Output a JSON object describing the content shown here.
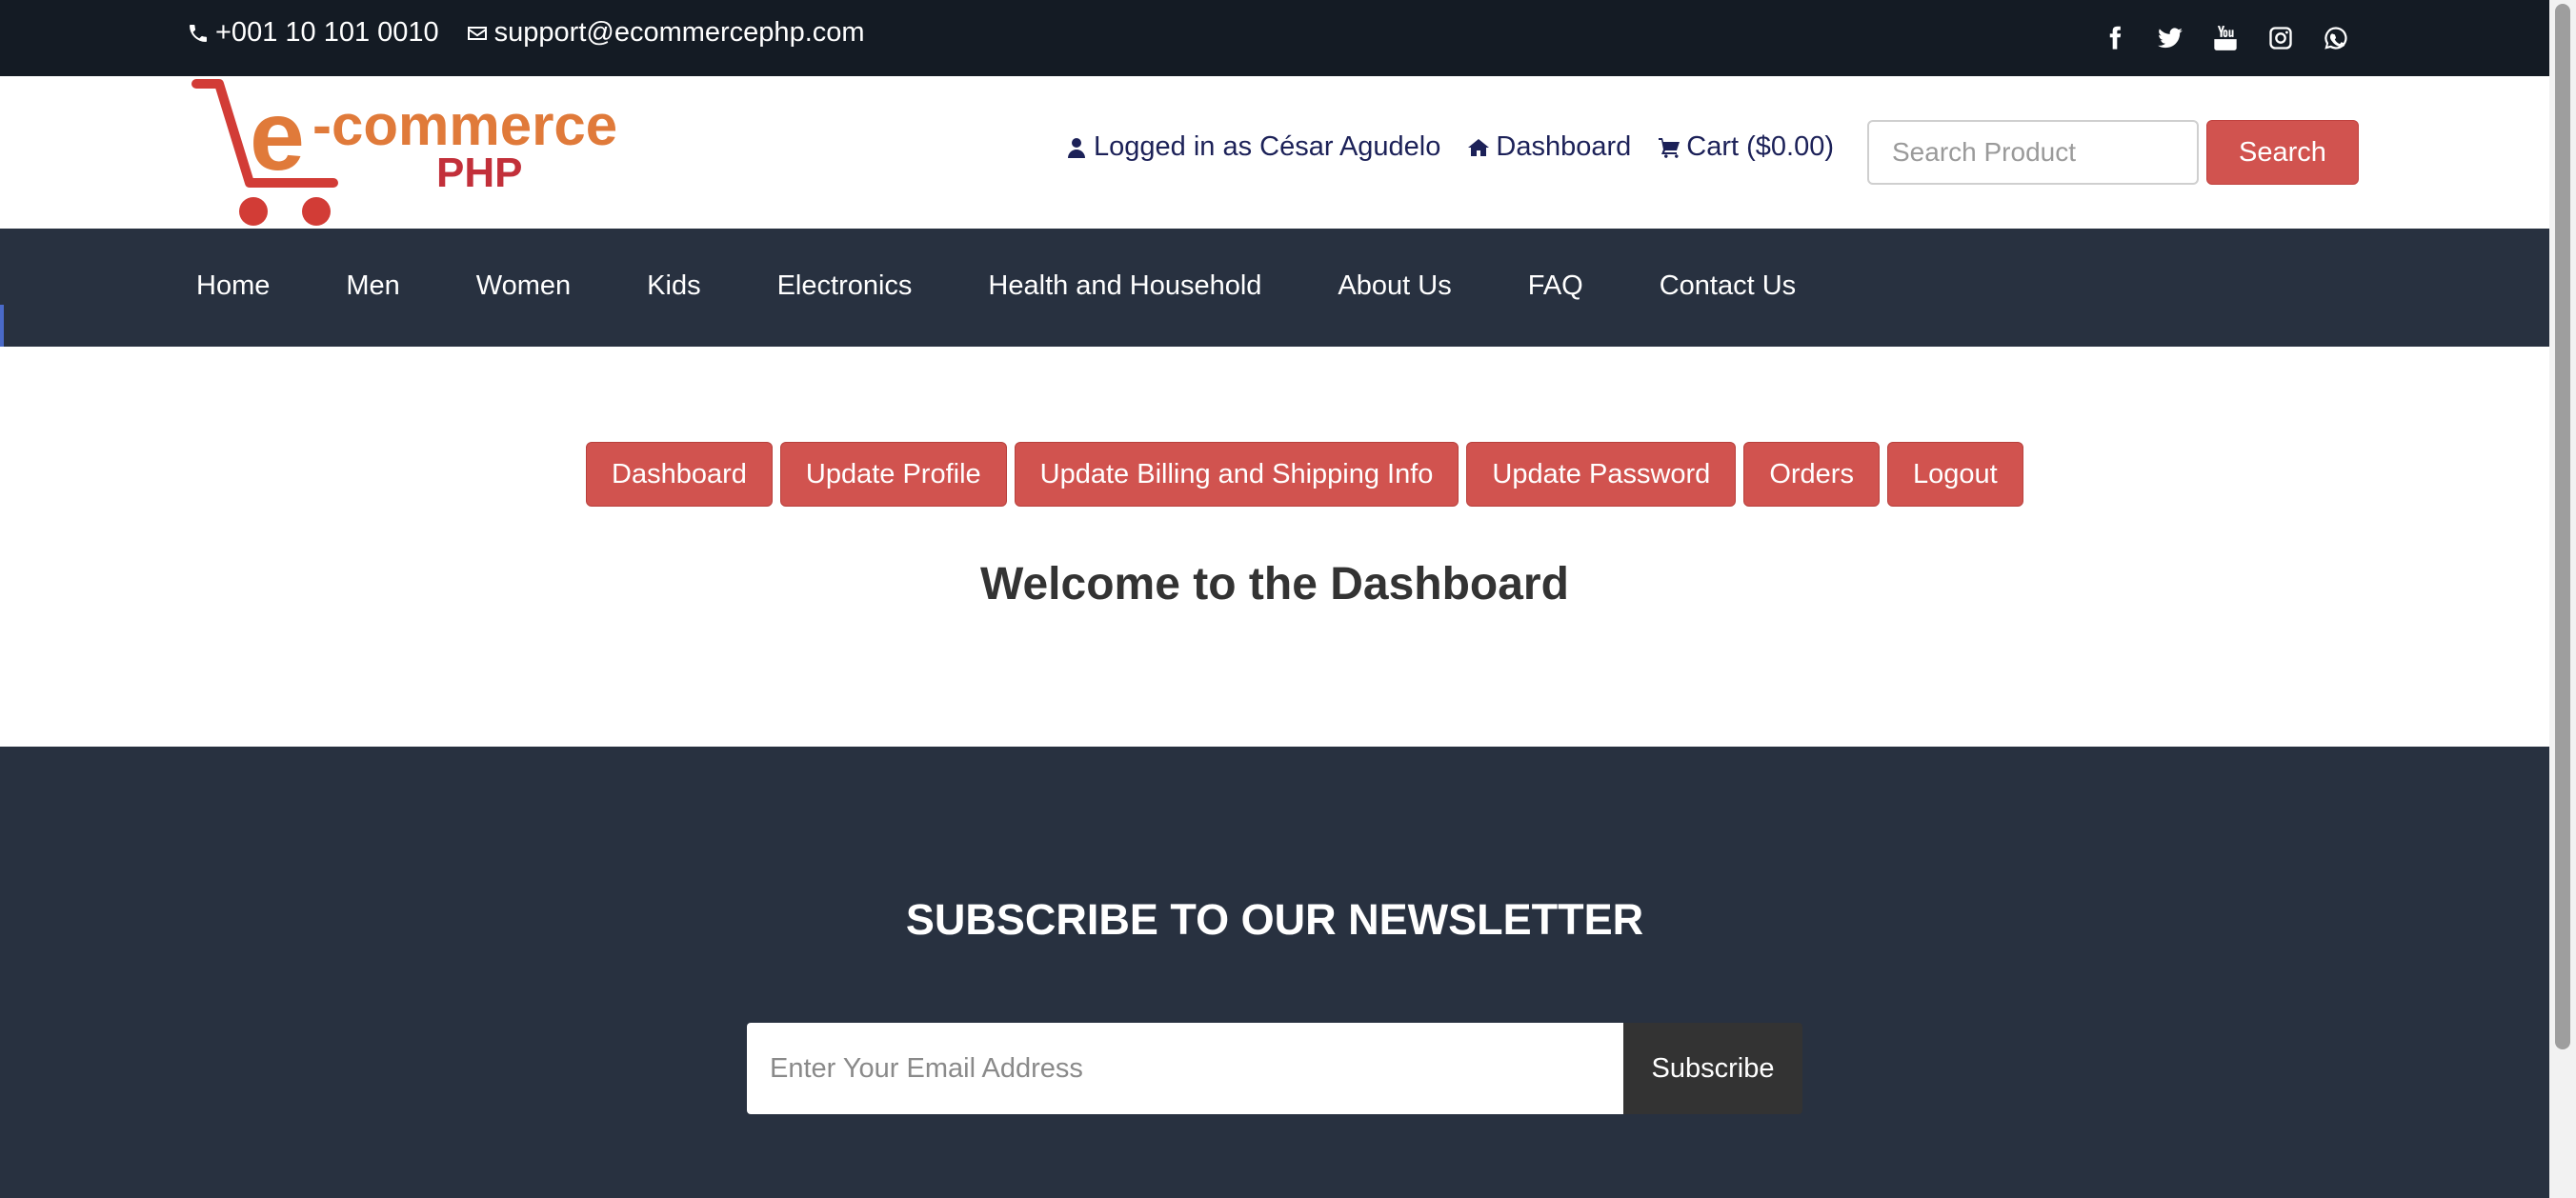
{
  "topbar": {
    "phone": "+001 10 101 0010",
    "email": "support@ecommercephp.com",
    "social_icons": [
      "facebook-icon",
      "twitter-icon",
      "youtube-icon",
      "instagram-icon",
      "whatsapp-icon"
    ]
  },
  "header": {
    "logo": {
      "main": "e-commerce",
      "sub": "PHP"
    },
    "logged_in": "Logged in as César Agudelo",
    "dashboard_link": "Dashboard",
    "cart_link": "Cart ($0.00)",
    "search_placeholder": "Search Product",
    "search_button": "Search"
  },
  "nav": {
    "items": [
      "Home",
      "Men",
      "Women",
      "Kids",
      "Electronics",
      "Health and Household",
      "About Us",
      "FAQ",
      "Contact Us"
    ]
  },
  "dashboard": {
    "tabs": [
      "Dashboard",
      "Update Profile",
      "Update Billing and Shipping Info",
      "Update Password",
      "Orders",
      "Logout"
    ],
    "welcome": "Welcome to the Dashboard"
  },
  "newsletter": {
    "title": "SUBSCRIBE TO OUR NEWSLETTER",
    "placeholder": "Enter Your Email Address",
    "button": "Subscribe"
  },
  "colors": {
    "accent": "#d1534f",
    "dark_bg": "#283140",
    "topbar_bg": "#141b24",
    "side_strip": [
      "#4a6ac9",
      "#000000",
      "#d33a2c",
      "#8a8a8a",
      "#a4d65e"
    ]
  }
}
